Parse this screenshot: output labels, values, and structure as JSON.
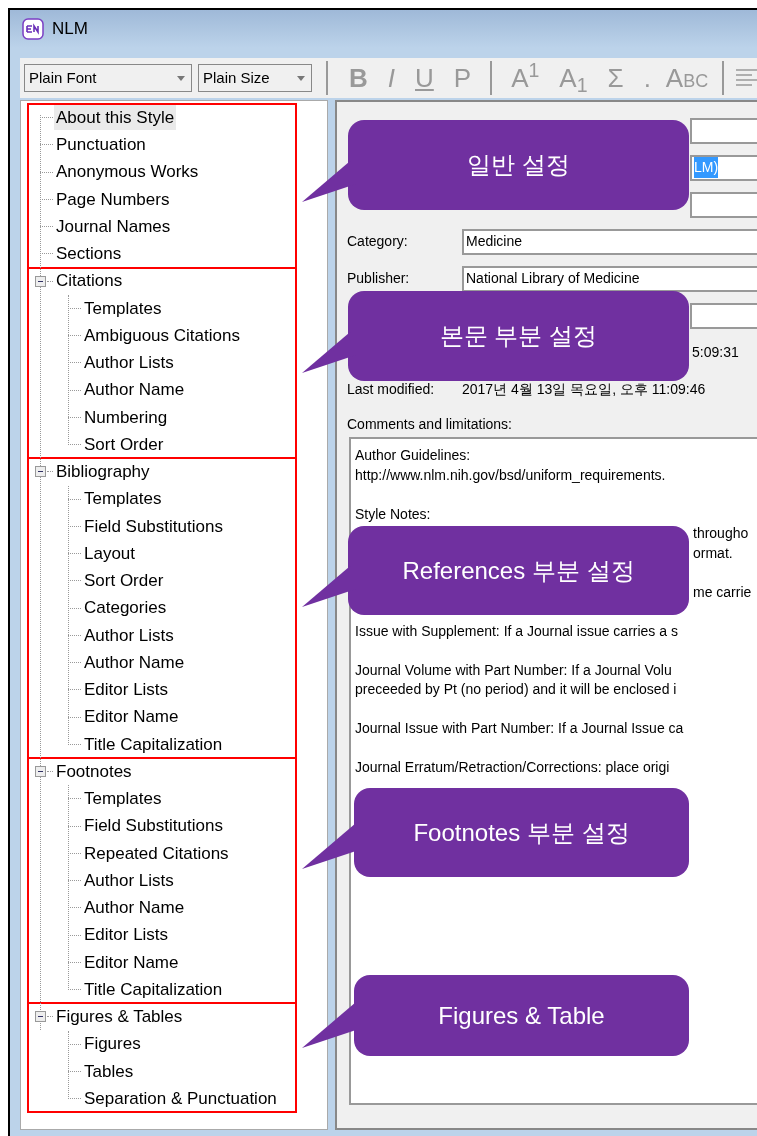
{
  "window": {
    "title": "NLM"
  },
  "toolbar": {
    "font_dropdown": "Plain Font",
    "size_dropdown": "Plain Size",
    "buttons": [
      {
        "kind": "bold",
        "label": "B"
      },
      {
        "kind": "italic",
        "label": "I"
      },
      {
        "kind": "underline",
        "label": "U"
      },
      {
        "kind": "text",
        "label": "P"
      },
      {
        "kind": "divider"
      },
      {
        "kind": "text",
        "label": "A$^{1}$"
      },
      {
        "kind": "text",
        "label": "A$_{1}$"
      },
      {
        "kind": "text",
        "label": "Σ"
      },
      {
        "kind": "text",
        "label": "."
      },
      {
        "kind": "caps",
        "label": "A",
        "small": "BC"
      },
      {
        "kind": "divider"
      },
      {
        "kind": "align"
      }
    ]
  },
  "tree": [
    {
      "callout": "일반 설정",
      "nodes": [
        {
          "label": "About this Style",
          "selected": true
        },
        {
          "label": "Punctuation",
          "selected": false
        },
        {
          "label": "Anonymous Works",
          "selected": false
        },
        {
          "label": "Page Numbers",
          "selected": false
        },
        {
          "label": "Journal Names",
          "selected": false
        },
        {
          "label": "Sections",
          "selected": false
        }
      ]
    },
    {
      "callout": "본문 부분 설정",
      "nodes": [
        {
          "label": "Citations",
          "selected": false,
          "expanded": true,
          "children": [
            {
              "label": "Templates",
              "selected": false
            },
            {
              "label": "Ambiguous Citations",
              "selected": false
            },
            {
              "label": "Author Lists",
              "selected": false
            },
            {
              "label": "Author Name",
              "selected": false
            },
            {
              "label": "Numbering",
              "selected": false
            },
            {
              "label": "Sort Order",
              "selected": false
            }
          ]
        }
      ]
    },
    {
      "callout": "References 부분 설정",
      "nodes": [
        {
          "label": "Bibliography",
          "selected": false,
          "expanded": true,
          "children": [
            {
              "label": "Templates",
              "selected": false
            },
            {
              "label": "Field Substitutions",
              "selected": false
            },
            {
              "label": "Layout",
              "selected": false
            },
            {
              "label": "Sort Order",
              "selected": false
            },
            {
              "label": "Categories",
              "selected": false
            },
            {
              "label": "Author Lists",
              "selected": false
            },
            {
              "label": "Author Name",
              "selected": false
            },
            {
              "label": "Editor Lists",
              "selected": false
            },
            {
              "label": "Editor Name",
              "selected": false
            },
            {
              "label": "Title Capitalization",
              "selected": false
            }
          ]
        }
      ]
    },
    {
      "callout": "Footnotes 부분 설정",
      "nodes": [
        {
          "label": "Footnotes",
          "selected": false,
          "expanded": true,
          "children": [
            {
              "label": "Templates",
              "selected": false
            },
            {
              "label": "Field Substitutions",
              "selected": false
            },
            {
              "label": "Repeated Citations",
              "selected": false
            },
            {
              "label": "Author Lists",
              "selected": false
            },
            {
              "label": "Author Name",
              "selected": false
            },
            {
              "label": "Editor Lists",
              "selected": false
            },
            {
              "label": "Editor Name",
              "selected": false
            },
            {
              "label": "Title Capitalization",
              "selected": false
            }
          ]
        }
      ]
    },
    {
      "callout": "Figures & Table",
      "nodes": [
        {
          "label": "Figures & Tables",
          "selected": false,
          "expanded": true,
          "children": [
            {
              "label": "Figures",
              "selected": false
            },
            {
              "label": "Tables",
              "selected": false
            },
            {
              "label": "Separation & Punctuation",
              "selected": false
            }
          ]
        }
      ]
    }
  ],
  "form": [
    {
      "kind": "covered_field"
    },
    {
      "kind": "covered_field",
      "value": "LM)",
      "value_selected": true
    },
    {
      "kind": "covered_field"
    },
    {
      "kind": "field",
      "label": "Category:",
      "value": "Medicine"
    },
    {
      "kind": "field",
      "label": "Publisher:",
      "value": "National Library of Medicine"
    },
    {
      "kind": "covered_field"
    },
    {
      "kind": "covered_info",
      "value": "5:09:31"
    },
    {
      "kind": "info",
      "label": "Last modified:",
      "value": "2017년 4월 13일 목요일, 오후 11:09:46"
    }
  ],
  "comments": {
    "label": "Comments and limitations:",
    "paragraphs": [
      {
        "lines": [
          {
            "kind": "text",
            "text": "Author Guidelines:"
          },
          {
            "kind": "text",
            "text": "http://www.nlm.nih.gov/bsd/uniform_requirements."
          }
        ]
      },
      {
        "lines": [
          {
            "kind": "text",
            "text": "Style Notes:"
          },
          {
            "kind": "fragment",
            "text": "througho"
          },
          {
            "kind": "fragment",
            "text": "ormat."
          }
        ]
      },
      {
        "lines": [
          {
            "kind": "fragment",
            "text": "me carrie"
          }
        ]
      },
      {
        "lines": [
          {
            "kind": "text",
            "text": "Issue with Supplement:  If a Journal issue carries a s"
          }
        ]
      },
      {
        "lines": [
          {
            "kind": "text",
            "text": "Journal Volume with Part Number:  If a Journal Volu"
          },
          {
            "kind": "text",
            "text": "preceeded by Pt (no period) and it will be enclosed i"
          }
        ]
      },
      {
        "lines": [
          {
            "kind": "text",
            "text": "Journal Issue with Part Number:  If a Journal Issue ca"
          }
        ]
      },
      {
        "lines": [
          {
            "kind": "text",
            "text": "Journal Erratum/Retraction/Corrections:  place origi"
          }
        ]
      }
    ]
  }
}
